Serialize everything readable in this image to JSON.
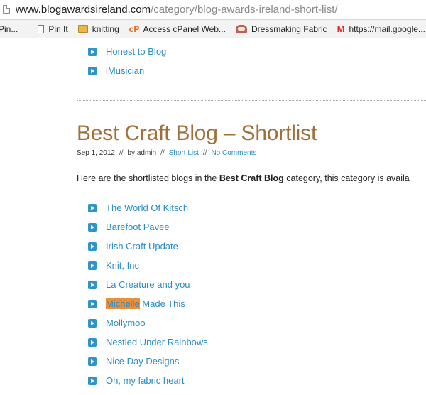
{
  "browser": {
    "url_host": "www.blogawardsireland.com",
    "url_path": "/category/blog-awards-ireland-short-list/",
    "bookmarks": [
      {
        "label": "Pin..."
      },
      {
        "label": "Pin It"
      },
      {
        "label": "knitting"
      },
      {
        "label": "Access cPanel Web..."
      },
      {
        "label": "Dressmaking Fabric"
      },
      {
        "label": "https://mail.google...."
      }
    ]
  },
  "top_list": [
    {
      "label": "Honest to Blog"
    },
    {
      "label": "iMusician"
    }
  ],
  "post": {
    "title": "Best Craft Blog – Shortlist",
    "date": "Sep 1, 2012",
    "separator": "//",
    "author": "by admin",
    "category": "Short List",
    "comments": "No Comments",
    "intro_before": "Here are the shortlisted blogs in the ",
    "intro_bold": "Best Craft Blog",
    "intro_after": " category, this category is availa"
  },
  "shortlist": [
    {
      "label": "The World Of Kitsch"
    },
    {
      "label": "Barefoot Pavee"
    },
    {
      "label": "Irish Craft Update"
    },
    {
      "label": "Knit, Inc"
    },
    {
      "label": "La Creature and you"
    },
    {
      "label_highlight": "Michelle",
      "label_rest": " Made This"
    },
    {
      "label": "Mollymoo"
    },
    {
      "label": "Nestled Under Rainbows"
    },
    {
      "label": "Nice Day Designs"
    },
    {
      "label": "Oh, my fabric heart"
    }
  ]
}
